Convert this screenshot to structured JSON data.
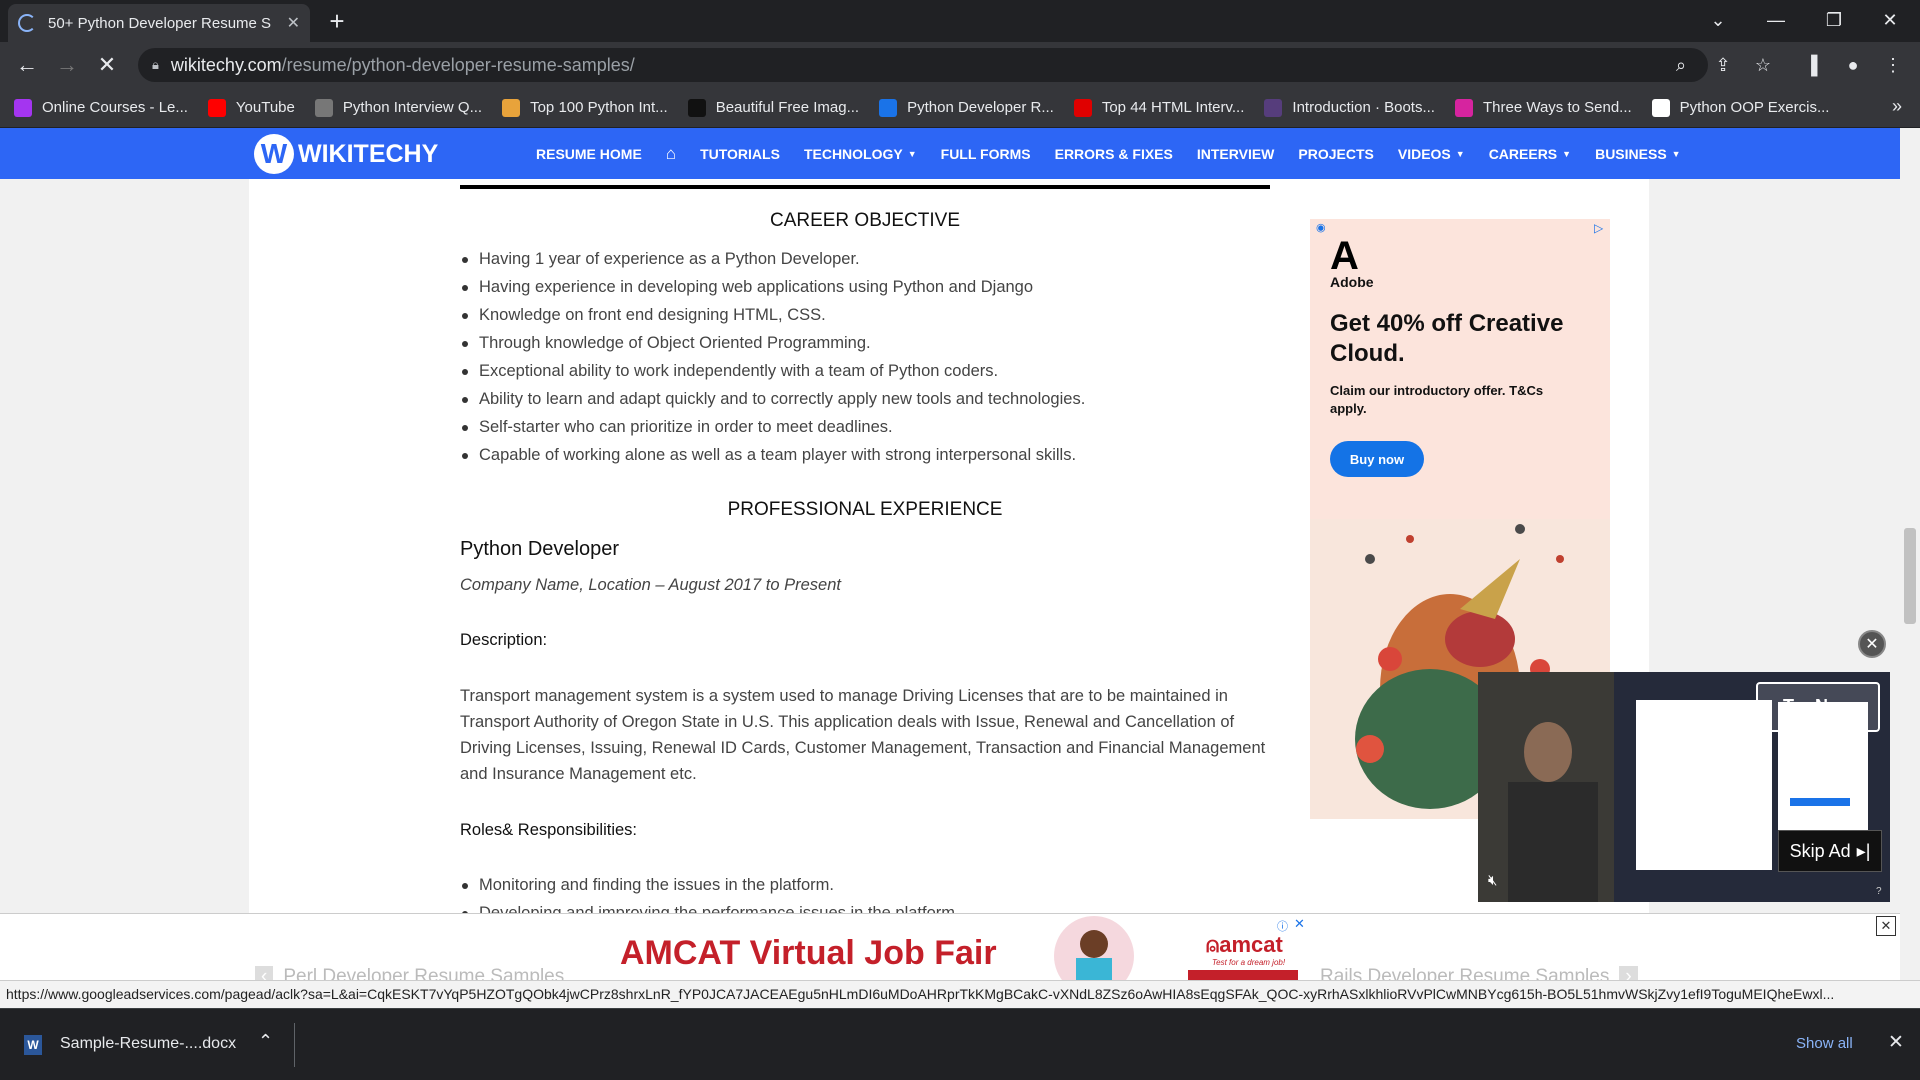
{
  "browser": {
    "tab_title": "50+ Python Developer Resume S",
    "url_domain": "wikitechy.com",
    "url_path": "/resume/python-developer-resume-samples/",
    "bookmarks": [
      {
        "label": "Online Courses - Le...",
        "icon": "udemy-icon",
        "color": "#a435f0"
      },
      {
        "label": "YouTube",
        "icon": "youtube-icon",
        "color": "#ff0000"
      },
      {
        "label": "Python Interview Q...",
        "icon": "globe-icon",
        "color": "#777777"
      },
      {
        "label": "Top 100 Python Int...",
        "icon": "torch-icon",
        "color": "#e8a33b"
      },
      {
        "label": "Beautiful Free Imag...",
        "icon": "unsplash-icon",
        "color": "#111111"
      },
      {
        "label": "Python Developer R...",
        "icon": "loading-icon",
        "color": "#1a73e8"
      },
      {
        "label": "Top 44 HTML Interv...",
        "icon": "v-icon",
        "color": "#e00000"
      },
      {
        "label": "Introduction · Boots...",
        "icon": "bootstrap-icon",
        "color": "#563d7c"
      },
      {
        "label": "Three Ways to Send...",
        "icon": "pink-icon",
        "color": "#d6249f"
      },
      {
        "label": "Python OOP Exercis...",
        "icon": "pynative-icon",
        "color": "#ffffff"
      }
    ],
    "status_url": "https://www.googleadservices.com/pagead/aclk?sa=L&ai=CqkESKT7vYqP5HZOTgQObk4jwCPrz8shrxLnR_fYP0JCA7JACEAEgu5nHLmDI6uMDoAHRprTkKMgBCakC-vXNdL8ZSz6oAwHIA8sEqgSFAk_QOC-xyRrhASxlkhlioRVvPlCwMNBYcg615h-BO5L51hmvWSkjZvy1efI9ToguMEIQheEwxl..."
  },
  "download": {
    "file_name": "Sample-Resume-....docx",
    "show_all": "Show all"
  },
  "site": {
    "logo_text": "WIKITECHY",
    "menu": [
      {
        "label": "RESUME HOME",
        "dropdown": false
      },
      {
        "label": "",
        "icon": "home-icon",
        "dropdown": false
      },
      {
        "label": "TUTORIALS",
        "dropdown": false
      },
      {
        "label": "TECHNOLOGY",
        "dropdown": true
      },
      {
        "label": "FULL FORMS",
        "dropdown": false
      },
      {
        "label": "ERRORS & FIXES",
        "dropdown": false
      },
      {
        "label": "INTERVIEW",
        "dropdown": false
      },
      {
        "label": "PROJECTS",
        "dropdown": false
      },
      {
        "label": "VIDEOS",
        "dropdown": true
      },
      {
        "label": "CAREERS",
        "dropdown": true
      },
      {
        "label": "BUSINESS",
        "dropdown": true
      }
    ],
    "brand_color": "#2d66f5"
  },
  "resume": {
    "career_heading": "CAREER OBJECTIVE",
    "career_items": [
      "Having 1 year of experience as a Python Developer.",
      "Having experience in developing web applications using Python and Django",
      "Knowledge on front end designing HTML, CSS.",
      "Through knowledge of Object Oriented Programming.",
      "Exceptional ability to work independently with a team of Python coders.",
      "Ability to learn and adapt quickly and to correctly apply new tools and technologies.",
      "Self-starter who can prioritize in order to meet deadlines.",
      "Capable of working alone as well as a team player with strong interpersonal skills."
    ],
    "experience_heading": "PROFESSIONAL EXPERIENCE",
    "job_title": "Python Developer",
    "job_meta": "Company Name, Location – August 2017 to Present",
    "description_label": "Description:",
    "description": "Transport management system is a system used to manage Driving Licenses that are to be maintained in Transport Authority of Oregon State in U.S. This application deals with Issue, Renewal and Cancellation of Driving Licenses, Issuing, Renewal ID Cards, Customer Management, Transaction and Financial Management and Insurance Management etc.",
    "roles_label": "Roles& Responsibilities:",
    "roles_items": [
      "Monitoring and finding the issues in the platform.",
      "Developing and improving the performance issues in the platform."
    ],
    "prev_link": "Perl Developer Resume Samples",
    "next_link": "Rails Developer Resume Samples"
  },
  "ads": {
    "adobe": {
      "brand": "Adobe",
      "headline": "Get 40% off Creative Cloud.",
      "sub": "Claim our introductory offer. T&Cs apply.",
      "button": "Buy now"
    },
    "video": {
      "try_now": "Try Now",
      "skip": "Skip Ad"
    },
    "amcat": {
      "headline": "AMCAT Virtual Job Fair",
      "brand": "amcat",
      "tagline": "Test for a dream job!"
    }
  }
}
